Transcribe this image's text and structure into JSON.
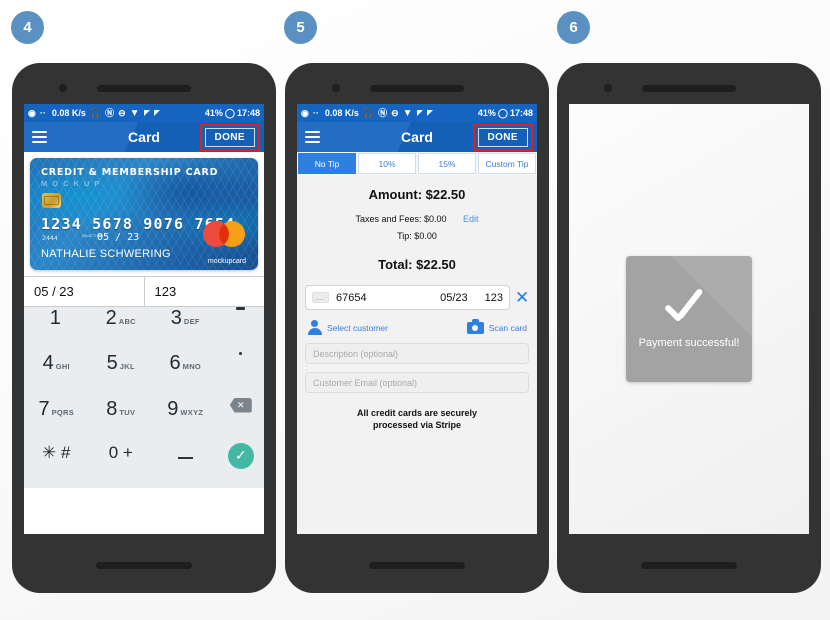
{
  "steps": [
    {
      "number": "4"
    },
    {
      "number": "5"
    },
    {
      "number": "6"
    }
  ],
  "status_bar": {
    "logo_icon": "spiral-logo-icon",
    "dots": "··",
    "net_speed": "0.08 K/s",
    "headphone_icon": "headphone-icon",
    "nfc_icon": "nfc-icon",
    "dnd_icon": "do-not-disturb-icon",
    "wifi_icon": "wifi-icon",
    "signal_icon_1": "signal-bars-icon",
    "signal_icon_2": "signal-bars-icon",
    "battery": "41%",
    "battery_icon": "battery-circle-icon",
    "time": "17:48"
  },
  "app_bar": {
    "menu_icon": "hamburger-menu-icon",
    "title": "Card",
    "done_label": "DONE"
  },
  "screen4": {
    "card": {
      "title": "CREDIT & MEMBERSHIP CARD",
      "subtitle": "MOCKUP",
      "number": "1234 5678 9076 7654",
      "small_number": "2444",
      "valid_label": "VALID THRU",
      "expiry": "05 / 23",
      "holder": "NATHALIE SCHWERING",
      "brand": "mockupcard",
      "chip_icon": "emv-chip-icon",
      "network_icon": "mastercard-icon"
    },
    "fields": {
      "expiry_value": "05 / 23",
      "cvc_value": "123"
    },
    "keypad": [
      {
        "digit": "1",
        "letters": ""
      },
      {
        "digit": "2",
        "letters": "ABC"
      },
      {
        "digit": "3",
        "letters": "DEF"
      },
      {
        "digit": "-",
        "letters": "",
        "icon": "dash-key-icon"
      },
      {
        "digit": "4",
        "letters": "GHI"
      },
      {
        "digit": "5",
        "letters": "JKL"
      },
      {
        "digit": "6",
        "letters": "MNO"
      },
      {
        "digit": ".",
        "letters": "",
        "icon": "dot-key-icon"
      },
      {
        "digit": "7",
        "letters": "PQRS"
      },
      {
        "digit": "8",
        "letters": "TUV"
      },
      {
        "digit": "9",
        "letters": "WXYZ"
      },
      {
        "digit": "",
        "letters": "",
        "icon": "backspace-icon"
      },
      {
        "digit": "✳ #",
        "letters": ""
      },
      {
        "digit": "0 +",
        "letters": ""
      },
      {
        "digit": "_",
        "letters": "",
        "icon": "underscore-key-icon"
      },
      {
        "digit": "",
        "letters": "",
        "icon": "check-confirm-icon"
      }
    ],
    "backspace_glyph": "✕",
    "check_glyph": "✓"
  },
  "screen5": {
    "tips": [
      {
        "label": "No Tip",
        "active": true
      },
      {
        "label": "10%",
        "active": false
      },
      {
        "label": "15%",
        "active": false
      },
      {
        "label": "Custom Tip",
        "active": false
      }
    ],
    "amount": "Amount: $22.50",
    "taxes": "Taxes and Fees: $0.00",
    "edit_label": "Edit",
    "tip": "Tip: $0.00",
    "total": "Total: $22.50",
    "card_entry": {
      "card_icon": "credit-card-icon",
      "number": "67654",
      "expiry": "05/23",
      "cvc": "123",
      "clear_glyph": "✕"
    },
    "select_customer": {
      "icon": "person-icon",
      "label": "Select customer"
    },
    "scan_card": {
      "icon": "camera-icon",
      "label": "Scan card"
    },
    "description_placeholder": "Description (optional)",
    "email_placeholder": "Customer Email (optional)",
    "stripe_note_line1": "All credit cards are securely",
    "stripe_note_line2": "processed via Stripe"
  },
  "screen6": {
    "toast_icon": "checkmark-icon",
    "toast_text": "Payment successful!"
  },
  "colors": {
    "badge": "#5b90c2",
    "app_bar": "#1565c0",
    "annotation": "#e02020",
    "accent_link": "#3b7dd8",
    "confirm": "#45b8a3",
    "toast_bg": "#a3a3a3"
  }
}
